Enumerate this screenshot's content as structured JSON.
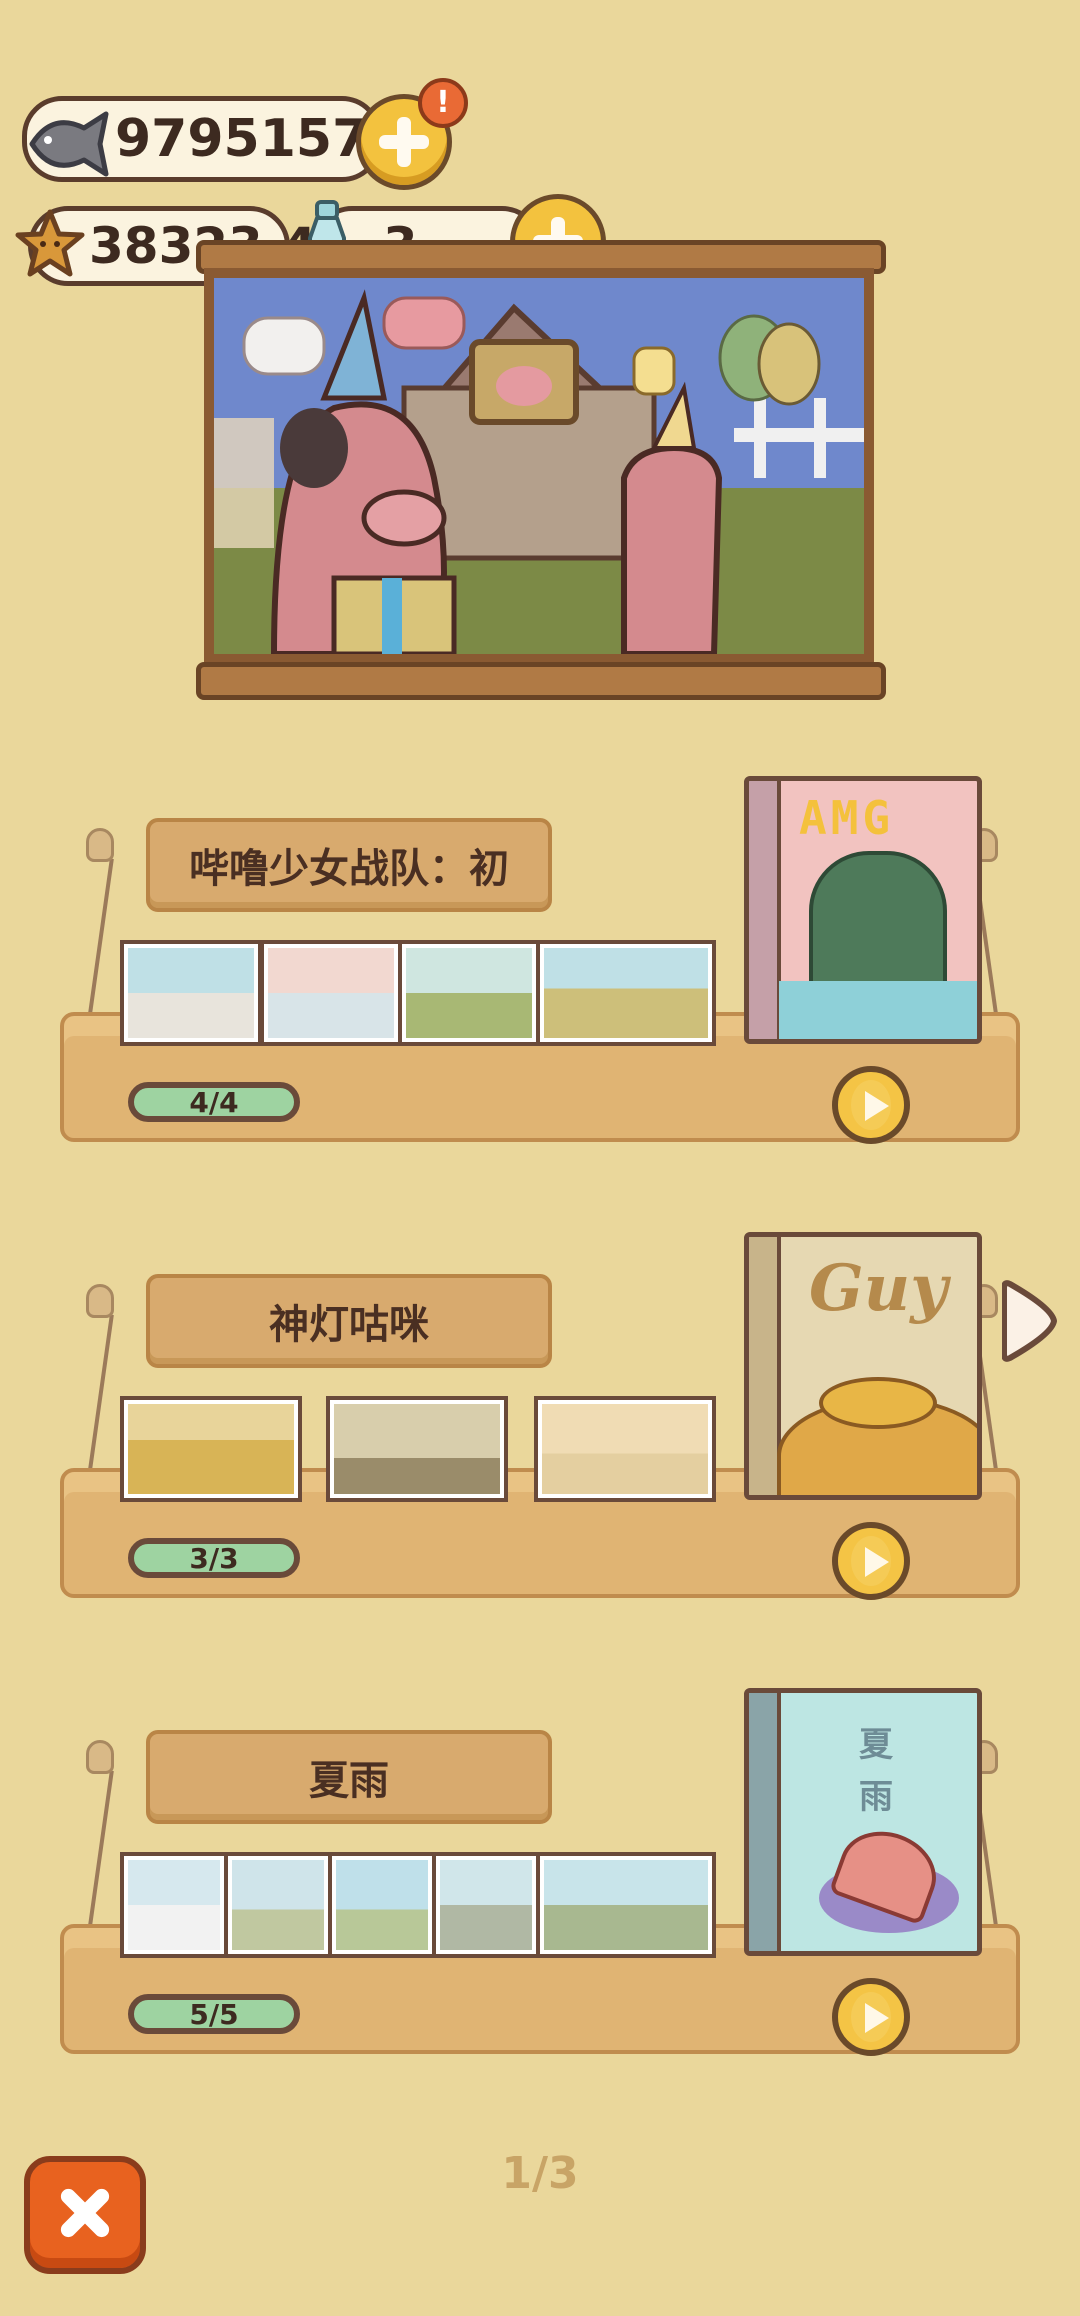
{
  "currency": {
    "fish_value": "9795157",
    "star_value": "38323.4",
    "bottle_value": "3",
    "alert_badge": "!"
  },
  "albums": [
    {
      "title": "哔噜少女战队：初",
      "progress": "4/4",
      "book_title": "AMG",
      "book_color": "#f4c8c4"
    },
    {
      "title": "神灯咕咪",
      "progress": "3/3",
      "book_title": "Guy",
      "book_color": "#e7d9b4"
    },
    {
      "title": "夏雨",
      "progress": "5/5",
      "book_title": "夏雨",
      "book_color": "#bde5e2"
    }
  ],
  "pagination": {
    "label": "1/3"
  },
  "icons": {
    "fish": "fish-icon",
    "star": "star-icon",
    "bottle": "milk-bottle-icon",
    "close": "close-icon",
    "play": "play-icon",
    "next": "chevron-right-icon"
  },
  "colors": {
    "background": "#ead79b",
    "accent_yellow": "#f3c23e",
    "close_orange": "#e8621f",
    "progress_green": "#9ed3a1"
  }
}
